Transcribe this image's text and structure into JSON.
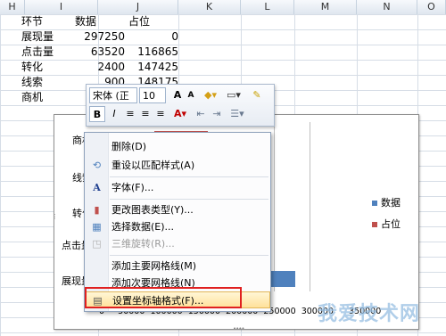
{
  "columns": [
    "H",
    "I",
    "J",
    "K",
    "L",
    "M",
    "N",
    "O"
  ],
  "rows": [
    {
      "h": "环节",
      "i": "数据",
      "j": "占位"
    },
    {
      "h": "展现量",
      "i": "297250",
      "j": "0"
    },
    {
      "h": "点击量",
      "i": "63520",
      "j": "116865"
    },
    {
      "h": "转化",
      "i": "2400",
      "j": "147425"
    },
    {
      "h": "线索",
      "i": "900",
      "j": "148175"
    },
    {
      "h": "商机",
      "i": "",
      "j": ""
    }
  ],
  "chart": {
    "categories": [
      "商机",
      "线索",
      "转化",
      "点击量",
      "展现量"
    ],
    "xaxis": [
      "0",
      "50000",
      "100000",
      "150000",
      "200000",
      "250000",
      "300000",
      "350000"
    ],
    "legend": [
      {
        "name": "数据",
        "color": "#4f81bd"
      },
      {
        "name": "占位",
        "color": "#c0504d"
      }
    ]
  },
  "toolbar": {
    "font": "宋体 (正文",
    "size": "10",
    "grow": "A",
    "shrink": "A",
    "bold": "B",
    "italic": "I"
  },
  "menu": [
    {
      "label": "删除(D)",
      "icon": "",
      "disabled": false
    },
    {
      "label": "重设以匹配样式(A)",
      "icon": "reset-style-icon",
      "disabled": false
    },
    {
      "label": "字体(F)...",
      "icon": "font-icon",
      "disabled": false
    },
    {
      "label": "更改图表类型(Y)...",
      "icon": "chart-type-icon",
      "disabled": false
    },
    {
      "label": "选择数据(E)...",
      "icon": "select-data-icon",
      "disabled": false
    },
    {
      "label": "三维旋转(R)...",
      "icon": "3d-rotate-icon",
      "disabled": true
    },
    {
      "label": "添加主要网格线(M)",
      "icon": "",
      "disabled": false
    },
    {
      "label": "添加次要网格线(N)",
      "icon": "",
      "disabled": false
    },
    {
      "label": "设置坐标轴格式(F)...",
      "icon": "format-axis-icon",
      "disabled": false
    }
  ],
  "watermark": "我爱技术网"
}
